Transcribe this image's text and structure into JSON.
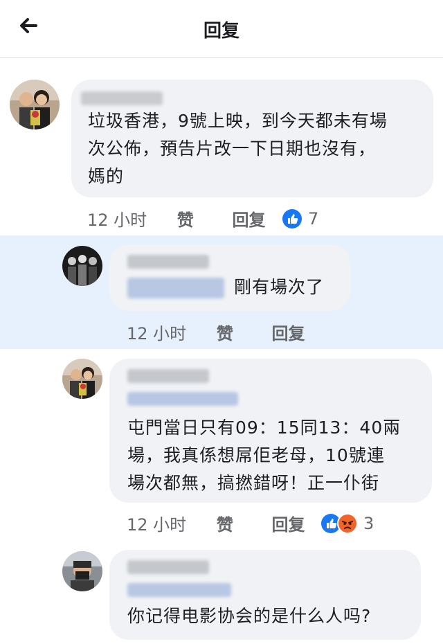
{
  "header": {
    "title": "回复"
  },
  "comments": [
    {
      "lines": [
        "垃圾香港，9號上映，到今天都未有場",
        "次公佈，預告片改一下日期也沒有，",
        "媽的"
      ],
      "time": "12 小时",
      "like": "赞",
      "reply": "回复",
      "reaction_count": "7"
    },
    {
      "lines": [
        "剛有場次了"
      ],
      "time": "12 小时",
      "like": "赞",
      "reply": "回复"
    },
    {
      "lines": [
        "屯門當日只有09：15同13：40兩",
        "場，我真係想屌佢老母，10號連",
        "場次都無，搞撚錯呀！正一仆街"
      ],
      "time": "12 小时",
      "like": "赞",
      "reply": "回复",
      "reaction_count": "3"
    },
    {
      "lines": [
        "你记得电影协会的是什么人吗?"
      ]
    }
  ],
  "colors": {
    "like_blue": "#1877f2",
    "angry_orange": "#f0642a",
    "highlight": "#e7f0fd",
    "bubble": "#f0f2f5"
  }
}
